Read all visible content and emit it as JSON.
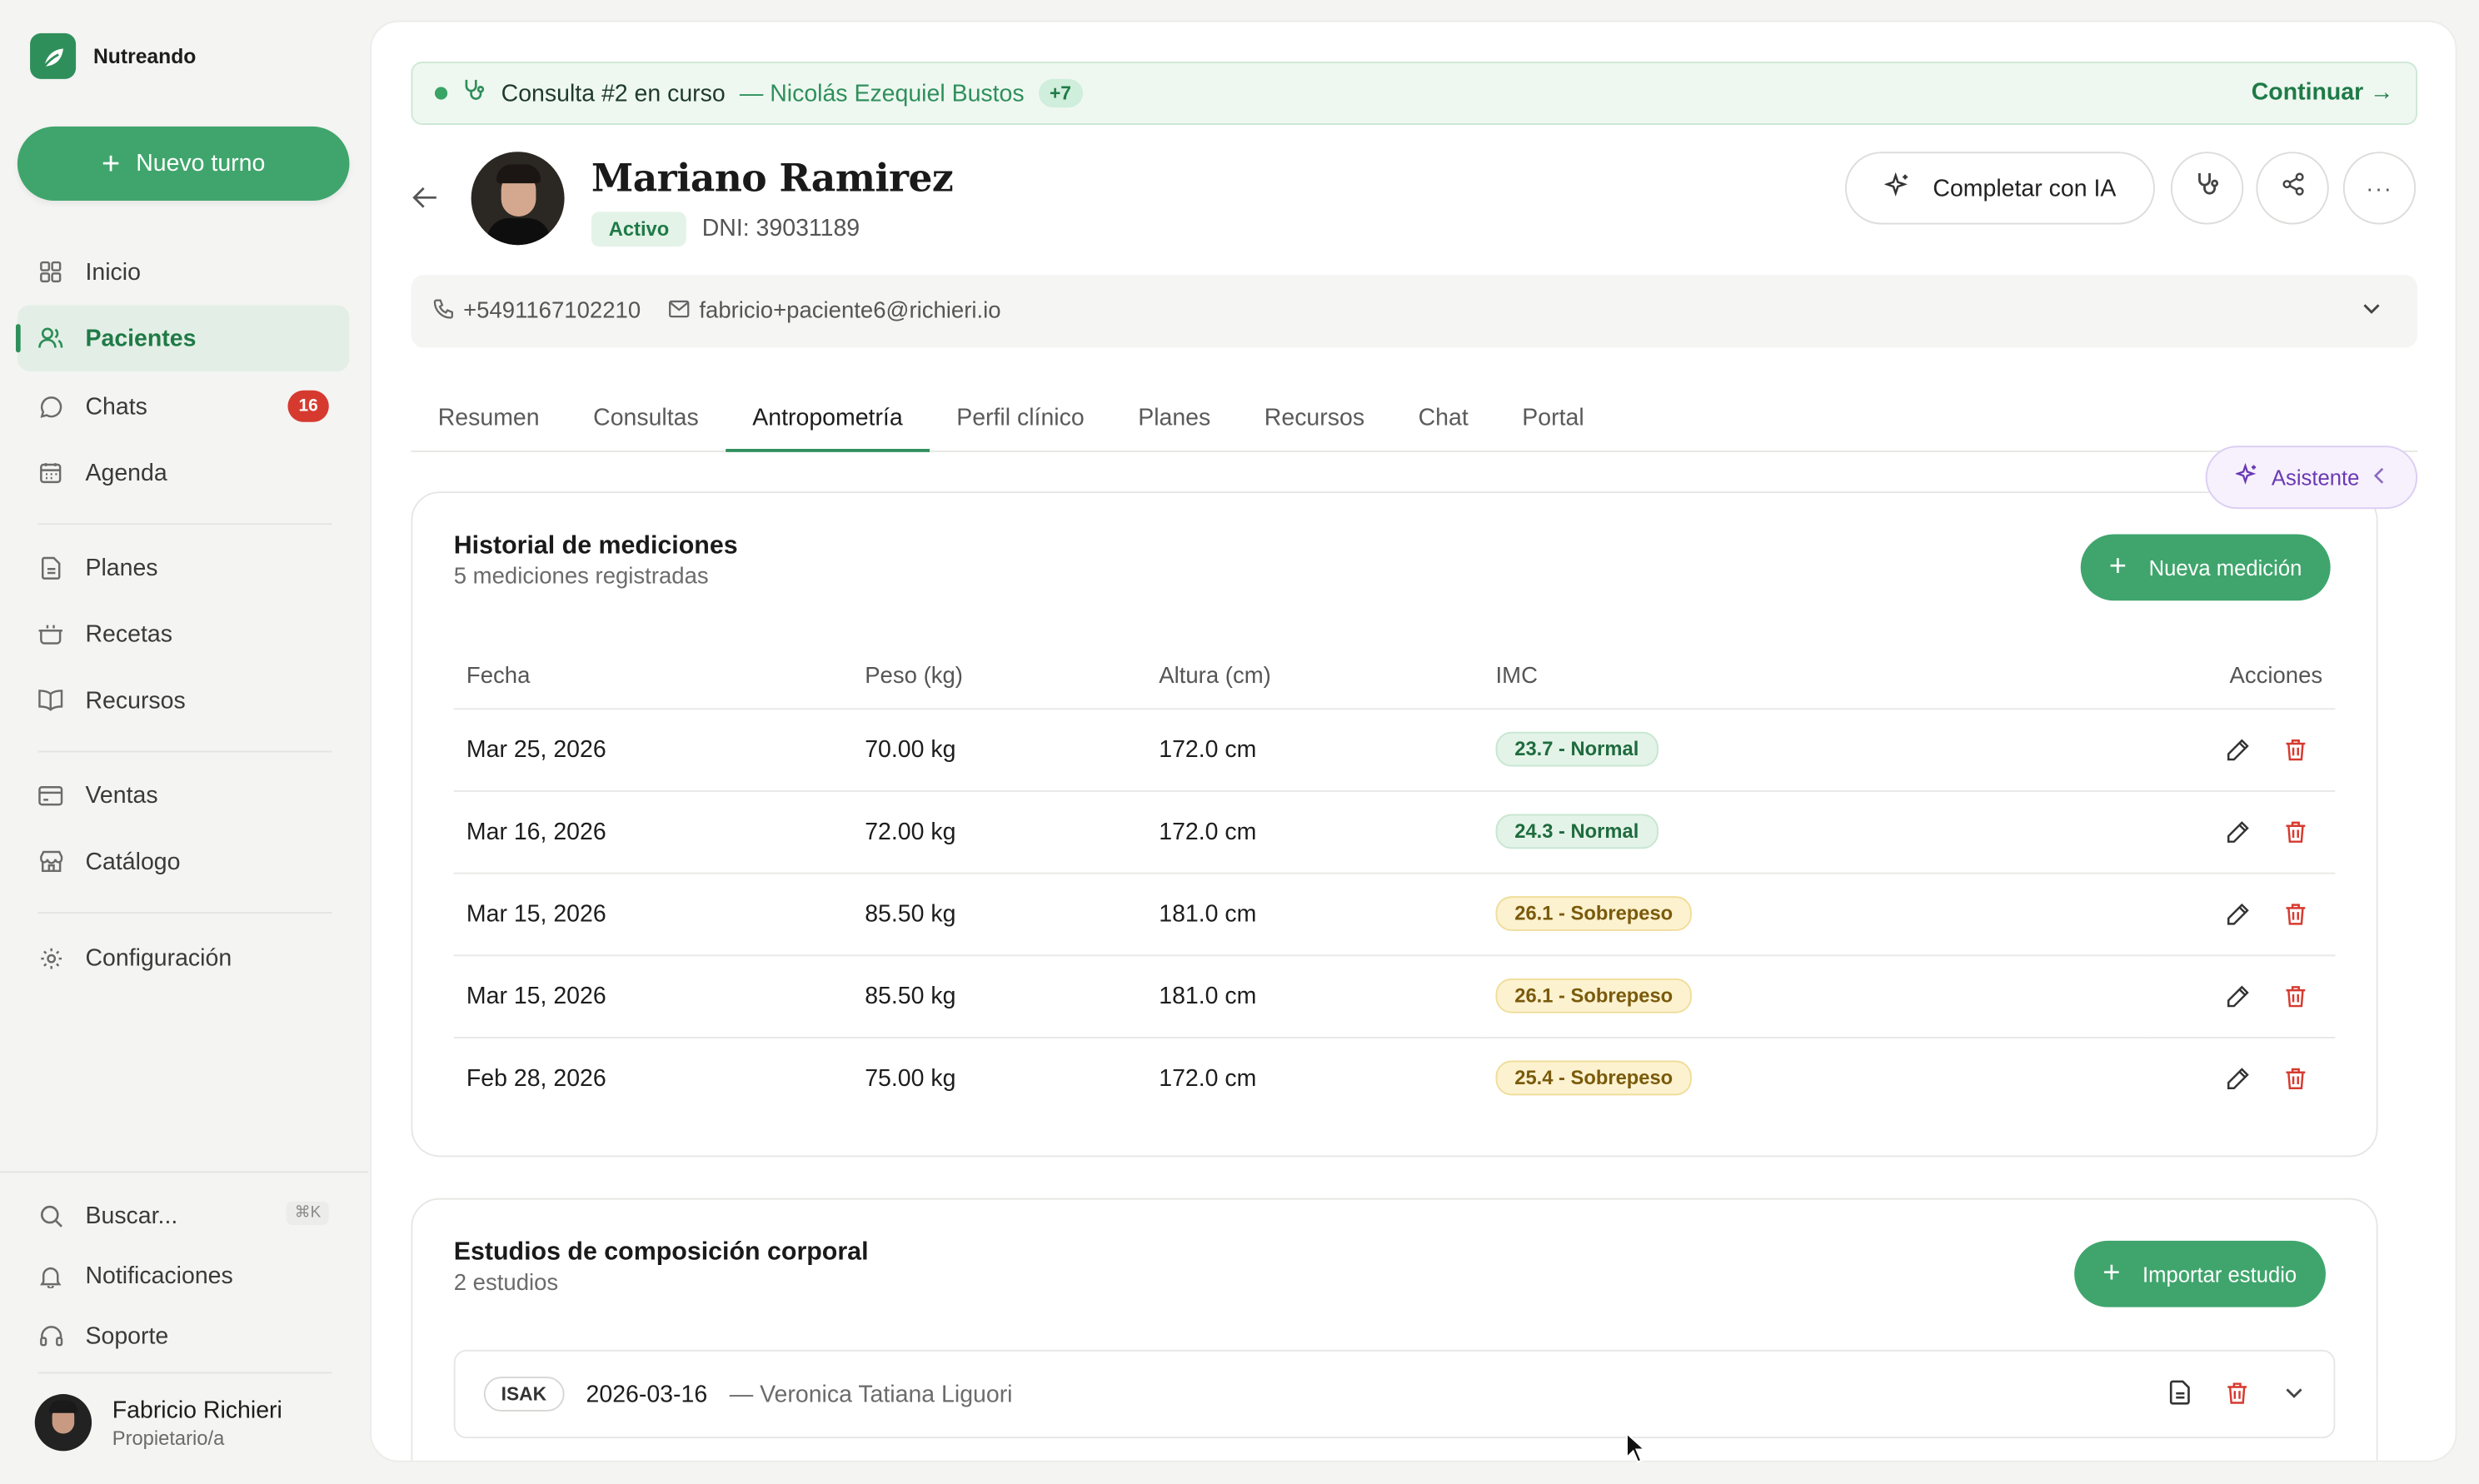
{
  "app": {
    "name": "Nutreando"
  },
  "sidebar": {
    "new_button": "Nuevo turno",
    "items": [
      {
        "label": "Inicio",
        "icon": "grid-icon"
      },
      {
        "label": "Pacientes",
        "icon": "users-icon",
        "active": true
      },
      {
        "label": "Chats",
        "icon": "chat-icon",
        "badge": "16"
      },
      {
        "label": "Agenda",
        "icon": "calendar-icon"
      },
      {
        "label": "Planes",
        "icon": "document-icon"
      },
      {
        "label": "Recetas",
        "icon": "pot-icon"
      },
      {
        "label": "Recursos",
        "icon": "book-icon"
      },
      {
        "label": "Ventas",
        "icon": "card-icon"
      },
      {
        "label": "Catálogo",
        "icon": "store-icon"
      },
      {
        "label": "Configuración",
        "icon": "gear-icon"
      }
    ],
    "bottom": {
      "search": "Buscar...",
      "search_shortcut": "⌘K",
      "notifications": "Notificaciones",
      "support": "Soporte"
    },
    "user": {
      "name": "Fabricio Richieri",
      "role": "Propietario/a"
    }
  },
  "consult_bar": {
    "text": "Consulta #2 en curso",
    "patient": "— Nicolás Ezequiel Bustos",
    "extra": "+7",
    "action": "Continuar →"
  },
  "patient": {
    "name": "Mariano Ramirez",
    "status": "Activo",
    "dni": "DNI: 39031189",
    "phone": "+5491167102210",
    "email": "fabricio+paciente6@richieri.io"
  },
  "header_actions": {
    "ai_button": "Completar con IA"
  },
  "tabs": [
    "Resumen",
    "Consultas",
    "Antropometría",
    "Perfil clínico",
    "Planes",
    "Recursos",
    "Chat",
    "Portal"
  ],
  "active_tab": "Antropometría",
  "assistant": {
    "label": "Asistente"
  },
  "measurements": {
    "title": "Historial de mediciones",
    "subtitle": "5 mediciones registradas",
    "new_button": "Nueva medición",
    "columns": [
      "Fecha",
      "Peso (kg)",
      "Altura (cm)",
      "IMC",
      "Acciones"
    ],
    "rows": [
      {
        "date": "Mar 25, 2026",
        "weight": "70.00 kg",
        "height": "172.0 cm",
        "imc": "23.7 - Normal",
        "status": "normal"
      },
      {
        "date": "Mar 16, 2026",
        "weight": "72.00 kg",
        "height": "172.0 cm",
        "imc": "24.3 - Normal",
        "status": "normal"
      },
      {
        "date": "Mar 15, 2026",
        "weight": "85.50 kg",
        "height": "181.0 cm",
        "imc": "26.1 - Sobrepeso",
        "status": "sobrepeso"
      },
      {
        "date": "Mar 15, 2026",
        "weight": "85.50 kg",
        "height": "181.0 cm",
        "imc": "26.1 - Sobrepeso",
        "status": "sobrepeso"
      },
      {
        "date": "Feb 28, 2026",
        "weight": "75.00 kg",
        "height": "172.0 cm",
        "imc": "25.4 - Sobrepeso",
        "status": "sobrepeso"
      }
    ]
  },
  "studies": {
    "title": "Estudios de composición corporal",
    "subtitle": "2 estudios",
    "import_button": "Importar estudio",
    "items": [
      {
        "type": "ISAK",
        "date": "2026-03-16",
        "author": "— Veronica Tatiana Liguori"
      }
    ]
  },
  "colors": {
    "accent": "#3fa56c",
    "accent_dark": "#1f7a47",
    "danger": "#d63a2f",
    "assistant": "#6a39b4"
  }
}
